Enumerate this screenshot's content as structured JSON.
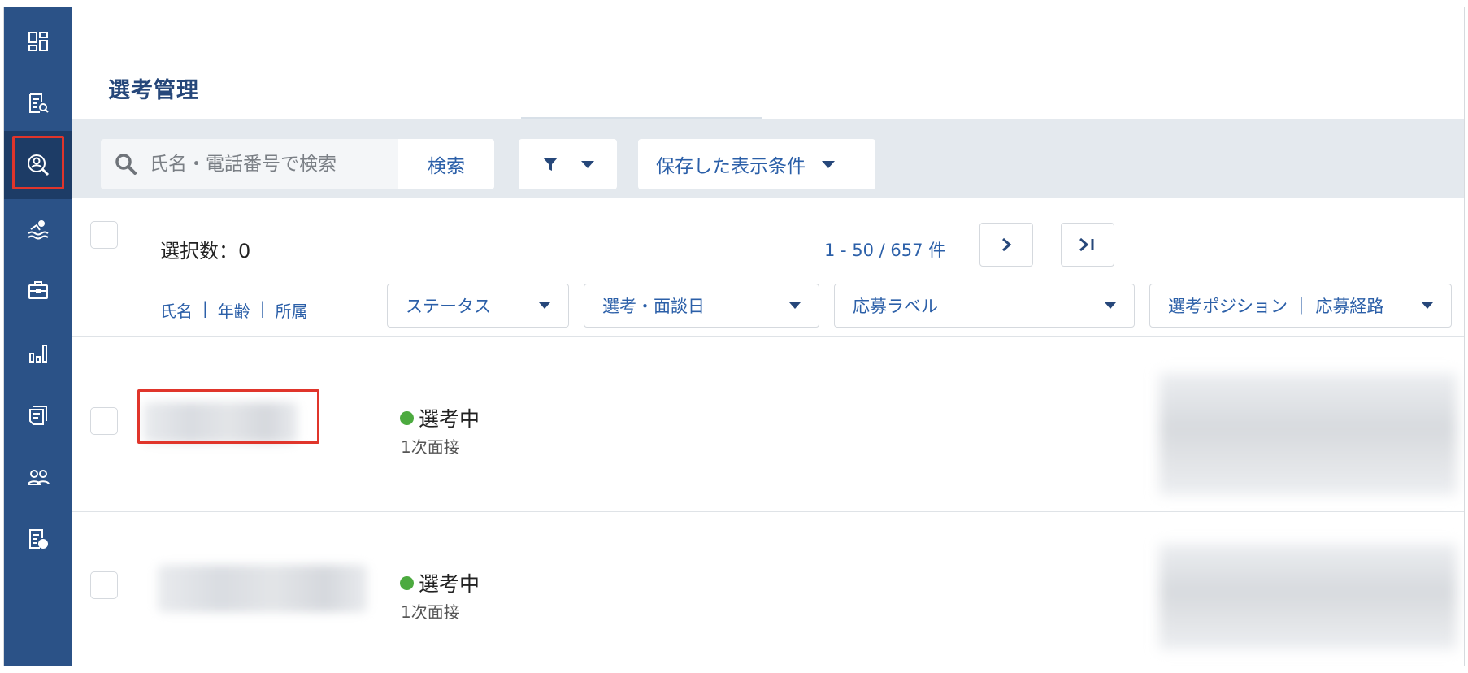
{
  "sidebar": {
    "items": [
      {
        "icon": "dashboard-icon",
        "active": false
      },
      {
        "icon": "document-search-icon",
        "active": false
      },
      {
        "icon": "person-search-icon",
        "active": true
      },
      {
        "icon": "swimmer-icon",
        "active": false
      },
      {
        "icon": "briefcase-icon",
        "active": false
      },
      {
        "icon": "bar-chart-icon",
        "active": false
      },
      {
        "icon": "documents-icon",
        "active": false
      },
      {
        "icon": "users-icon",
        "active": false
      },
      {
        "icon": "document-export-icon",
        "active": false
      }
    ]
  },
  "page": {
    "title": "選考管理"
  },
  "search": {
    "placeholder": "氏名・電話番号で検索",
    "button_label": "検索"
  },
  "saved_conditions": {
    "label": "保存した表示条件"
  },
  "selection": {
    "count_label": "選択数：0"
  },
  "pagination": {
    "info": "1 - 50 / 657 件",
    "next_label": ">",
    "last_label": ">|"
  },
  "columns": {
    "name_group": [
      "氏名",
      "|",
      "年齢",
      "|",
      "所属"
    ],
    "status": "ステータス",
    "date": "選考・面談日",
    "label": "応募ラベル",
    "position": "選考ポジション ｜ 応募経路"
  },
  "rows": [
    {
      "status": "選考中",
      "stage": "1次面接"
    },
    {
      "status": "選考中",
      "stage": "1次面接"
    }
  ],
  "colors": {
    "sidebar": "#2b5287",
    "sidebar_active": "#1d3c66",
    "accent": "#2b5fa8",
    "highlight": "#e0352b",
    "status_active": "#4caa3f",
    "toolbar": "#e4e9ee"
  }
}
